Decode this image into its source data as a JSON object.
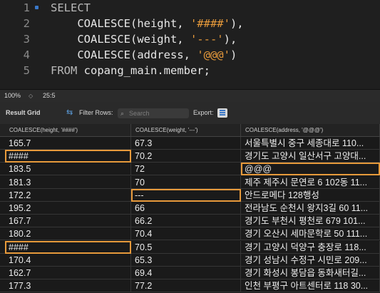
{
  "editor": {
    "lines": [
      {
        "num": "1",
        "parts": [
          {
            "t": "SELECT",
            "c": "kw"
          }
        ]
      },
      {
        "num": "2",
        "parts": [
          {
            "t": "    COALESCE(height, ",
            "c": "fn"
          },
          {
            "t": "'####'",
            "c": "str"
          },
          {
            "t": "),",
            "c": "dim"
          }
        ]
      },
      {
        "num": "3",
        "parts": [
          {
            "t": "    COALESCE(weight, ",
            "c": "fn"
          },
          {
            "t": "'---'",
            "c": "str"
          },
          {
            "t": "),",
            "c": "dim"
          }
        ]
      },
      {
        "num": "4",
        "parts": [
          {
            "t": "    COALESCE(address, ",
            "c": "fn"
          },
          {
            "t": "'@@@'",
            "c": "str"
          },
          {
            "t": ")",
            "c": "dim"
          }
        ]
      },
      {
        "num": "5",
        "parts": [
          {
            "t": "FROM ",
            "c": "kw"
          },
          {
            "t": "copang_main.member;",
            "c": "fn"
          }
        ]
      }
    ]
  },
  "statusbar": {
    "zoom": "100%",
    "zoom_stepper": "◇",
    "position": "25:5"
  },
  "toolbar": {
    "result_grid": "Result Grid",
    "filter_rows": "Filter Rows:",
    "search_placeholder": "Search",
    "export": "Export:"
  },
  "grid": {
    "columns": [
      "COALESCE(height, '####')",
      "COALESCE(weight, '---')",
      "COALESCE(address, '@@@')"
    ],
    "rows": [
      [
        "165.7",
        "67.3",
        "서울특별시 중구 세종대로 110..."
      ],
      [
        "####",
        "70.2",
        "경기도 고양시 일산서구 고양대..."
      ],
      [
        "183.5",
        "72",
        "@@@"
      ],
      [
        "181.3",
        "70",
        "제주 제주시 문연로 6 102동 11..."
      ],
      [
        "172.2",
        "---",
        "안드로메다 128행성"
      ],
      [
        "195.2",
        "66",
        "전라남도 순천시 왕지3길 60 11..."
      ],
      [
        "167.7",
        "66.2",
        "경기도 부천시 평천로 679 101..."
      ],
      [
        "180.2",
        "70.4",
        "경기 오산시 세마문학로 50 111..."
      ],
      [
        "####",
        "70.5",
        "경기 고양시 덕양구 충장로 118..."
      ],
      [
        "170.4",
        "65.3",
        "경기 성남시 수정구 시민로 209..."
      ],
      [
        "162.7",
        "69.4",
        "경기 화성시 봉담읍 동화새터길..."
      ],
      [
        "177.3",
        "77.2",
        "인천 부평구 아트센터로 118 30..."
      ]
    ],
    "highlights": [
      [
        1,
        0
      ],
      [
        2,
        2
      ],
      [
        4,
        1
      ],
      [
        8,
        0
      ]
    ]
  },
  "colors": {
    "accent": "#e79a3b",
    "background": "#1e1e1e"
  }
}
